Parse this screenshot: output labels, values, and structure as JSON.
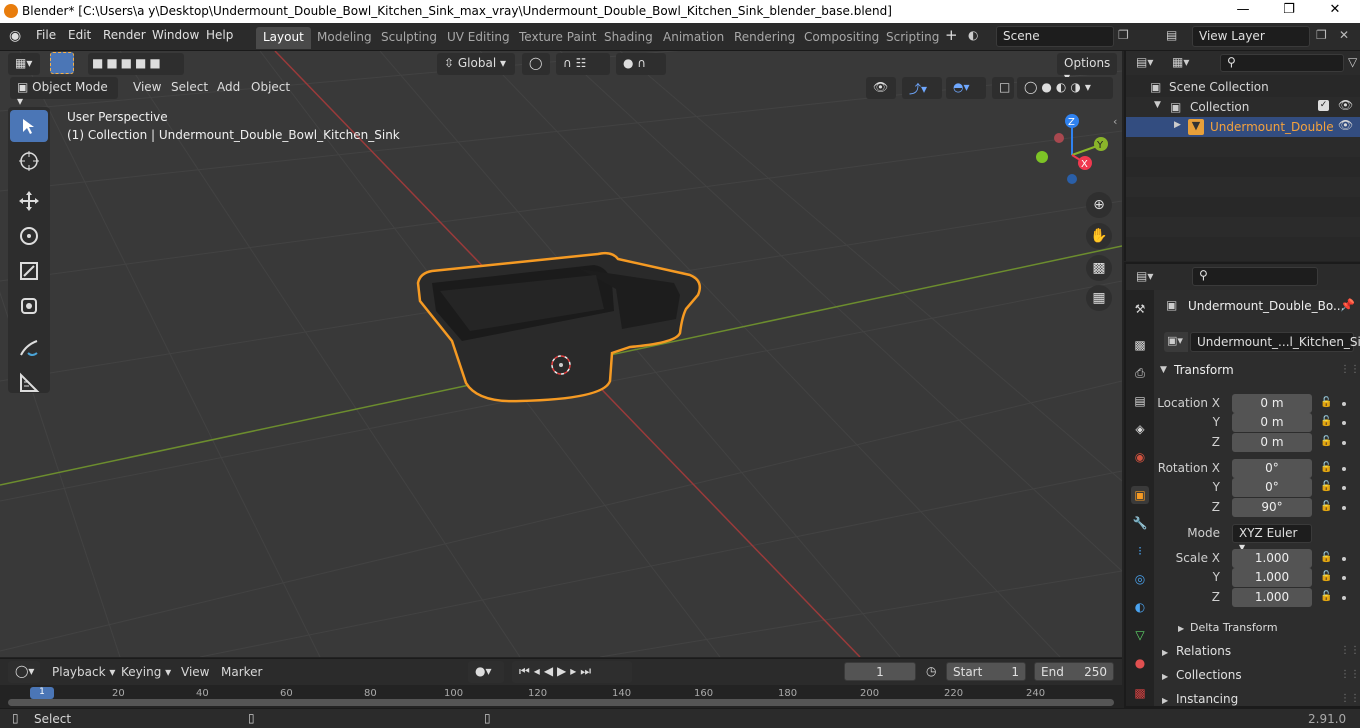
{
  "window": {
    "title": "Blender* [C:\\Users\\a y\\Desktop\\Undermount_Double_Bowl_Kitchen_Sink_max_vray\\Undermount_Double_Bowl_Kitchen_Sink_blender_base.blend]"
  },
  "menu": {
    "file": "File",
    "edit": "Edit",
    "render": "Render",
    "window": "Window",
    "help": "Help"
  },
  "workspaces": [
    {
      "label": "Layout",
      "active": true
    },
    {
      "label": "Modeling"
    },
    {
      "label": "Sculpting"
    },
    {
      "label": "UV Editing"
    },
    {
      "label": "Texture Paint"
    },
    {
      "label": "Shading"
    },
    {
      "label": "Animation"
    },
    {
      "label": "Rendering"
    },
    {
      "label": "Compositing"
    },
    {
      "label": "Scripting"
    }
  ],
  "scene": {
    "label": "Scene"
  },
  "view_layer": {
    "label": "View Layer"
  },
  "viewport": {
    "transform_orientation": "Global",
    "options": "Options",
    "mode": "Object Mode",
    "menus": {
      "view": "View",
      "select": "Select",
      "add": "Add",
      "object": "Object"
    },
    "overlay_line1": "User Perspective",
    "overlay_line2": "(1) Collection | Undermount_Double_Bowl_Kitchen_Sink",
    "gizmo": {
      "x": "X",
      "y": "Y",
      "z": "Z"
    }
  },
  "outliner": {
    "scene_collection": "Scene Collection",
    "collection": "Collection",
    "object": "Undermount_Double"
  },
  "properties": {
    "object_name": "Undermount_Double_Bo...",
    "data_name": "Undermount_...l_Kitchen_Sink",
    "transform_header": "Transform",
    "location_label": "Location X",
    "rotation_label": "Rotation X",
    "scale_label": "Scale X",
    "y_label": "Y",
    "z_label": "Z",
    "location": {
      "x": "0 m",
      "y": "0 m",
      "z": "0 m"
    },
    "rotation": {
      "x": "0°",
      "y": "0°",
      "z": "90°"
    },
    "mode_label": "Mode",
    "mode_value": "XYZ Euler",
    "scale": {
      "x": "1.000",
      "y": "1.000",
      "z": "1.000"
    },
    "delta_transform": "Delta Transform",
    "relations": "Relations",
    "collections": "Collections",
    "instancing": "Instancing"
  },
  "timeline": {
    "playback": "Playback",
    "keying": "Keying",
    "view": "View",
    "marker": "Marker",
    "current_frame": "1",
    "start_label": "Start",
    "start_value": "1",
    "end_label": "End",
    "end_value": "250",
    "ticks": [
      "1",
      "20",
      "40",
      "60",
      "80",
      "100",
      "120",
      "140",
      "160",
      "180",
      "200",
      "220",
      "240"
    ]
  },
  "status": {
    "select": "Select",
    "version": "2.91.0"
  },
  "colors": {
    "accent": "#4b76b6",
    "selection": "#f59a23",
    "x_axis": "#f0394f",
    "y_axis": "#8ab52a",
    "z_axis": "#2f82f0"
  }
}
